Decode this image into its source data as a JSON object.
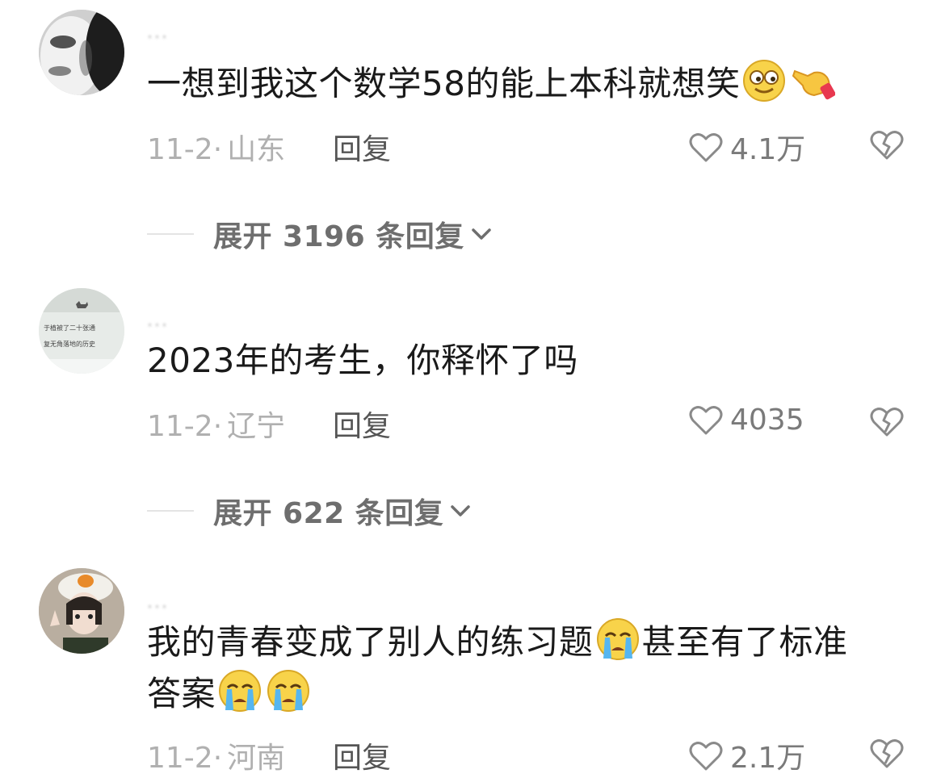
{
  "comments": [
    {
      "username": "...",
      "text": "一想到我这个数学58的能上本科就想笑",
      "date": "11-2",
      "location": "山东",
      "reply_label": "回复",
      "likes": "4.1万",
      "expand_label": "展开 3196 条回复"
    },
    {
      "username": "...",
      "text": "2023年的考生，你释怀了吗",
      "date": "11-2",
      "location": "辽宁",
      "reply_label": "回复",
      "likes": "4035",
      "expand_label": "展开 622 条回复",
      "avatar_text_line1": "于植被了二十张通",
      "avatar_text_line2": "复无角落地的历史"
    },
    {
      "username": "...",
      "text_part1": "我的青春变成了别人的练习题",
      "text_part2": "甚至有了标准",
      "text_part3": "答案",
      "date": "11-2",
      "location": "河南",
      "reply_label": "回复",
      "likes": "2.1万"
    }
  ],
  "icons": {
    "emoji_smirk": "smirk-emoji",
    "emoji_point": "pointing-hand-emoji",
    "emoji_cry": "crying-face-emoji",
    "like": "heart-outline-icon",
    "dislike": "broken-heart-icon",
    "expand": "chevron-down-icon"
  },
  "colors": {
    "meta_gray": "#b0b0b0",
    "text": "#1a1a1a",
    "expand_text": "#6e6e6e"
  }
}
